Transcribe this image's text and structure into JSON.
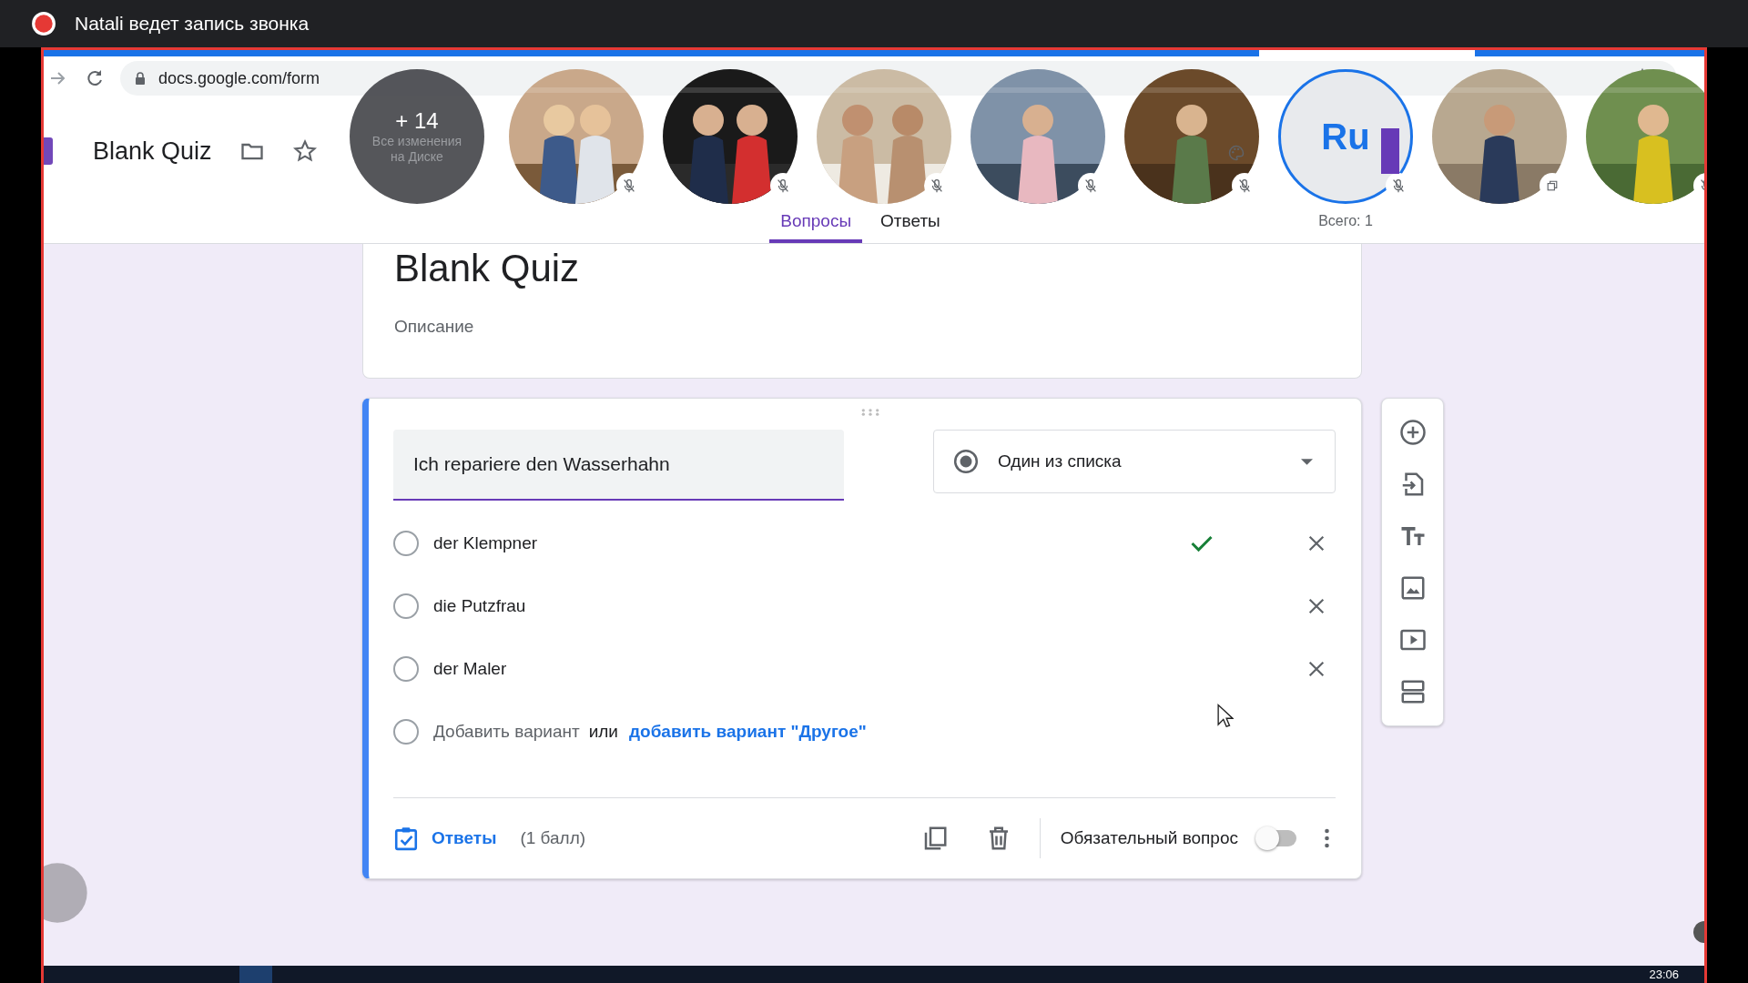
{
  "recording_banner": {
    "text": "Natali ведет запись звонка"
  },
  "browser": {
    "url": "docs.google.com/form"
  },
  "form_header": {
    "title": "Blank Quiz"
  },
  "participants": {
    "more": {
      "count": "+ 14",
      "hint": [
        "Все изменения",
        "на Диске"
      ]
    },
    "tiles": [
      {
        "kind": "picture",
        "muted": true
      },
      {
        "kind": "picture",
        "muted": true
      },
      {
        "kind": "picture",
        "muted": true
      },
      {
        "kind": "picture",
        "muted": true
      },
      {
        "kind": "picture",
        "muted": true
      },
      {
        "kind": "initials",
        "initials": "Ru",
        "muted": true,
        "caption": "Всего: 1"
      },
      {
        "kind": "picture",
        "muted": false
      },
      {
        "kind": "picture",
        "muted": true
      }
    ]
  },
  "tabs": [
    {
      "label": "Вопросы",
      "selected": true
    },
    {
      "label": "Ответы",
      "selected": false
    }
  ],
  "form_card": {
    "title": "Blank Quiz",
    "placeholder": "Описание"
  },
  "question": {
    "title": "Ich repariere den Wasserhahn",
    "type": "Один из списка",
    "options": [
      {
        "label": "der Klempner",
        "correct": true,
        "selected": false
      },
      {
        "label": "die Putzfrau",
        "correct": false,
        "selected": false
      },
      {
        "label": "der Maler",
        "correct": false,
        "selected": false
      }
    ],
    "add_option": {
      "placeholder": "Добавить вариант",
      "or": "или",
      "link": "добавить вариант \"Другое\"",
      "selected": false
    },
    "answer_key": "Ответы",
    "points": "(1 балл)",
    "required": {
      "label": "Обязательный вопрос",
      "on": false
    }
  },
  "taskbar": {
    "time": "23:06"
  }
}
